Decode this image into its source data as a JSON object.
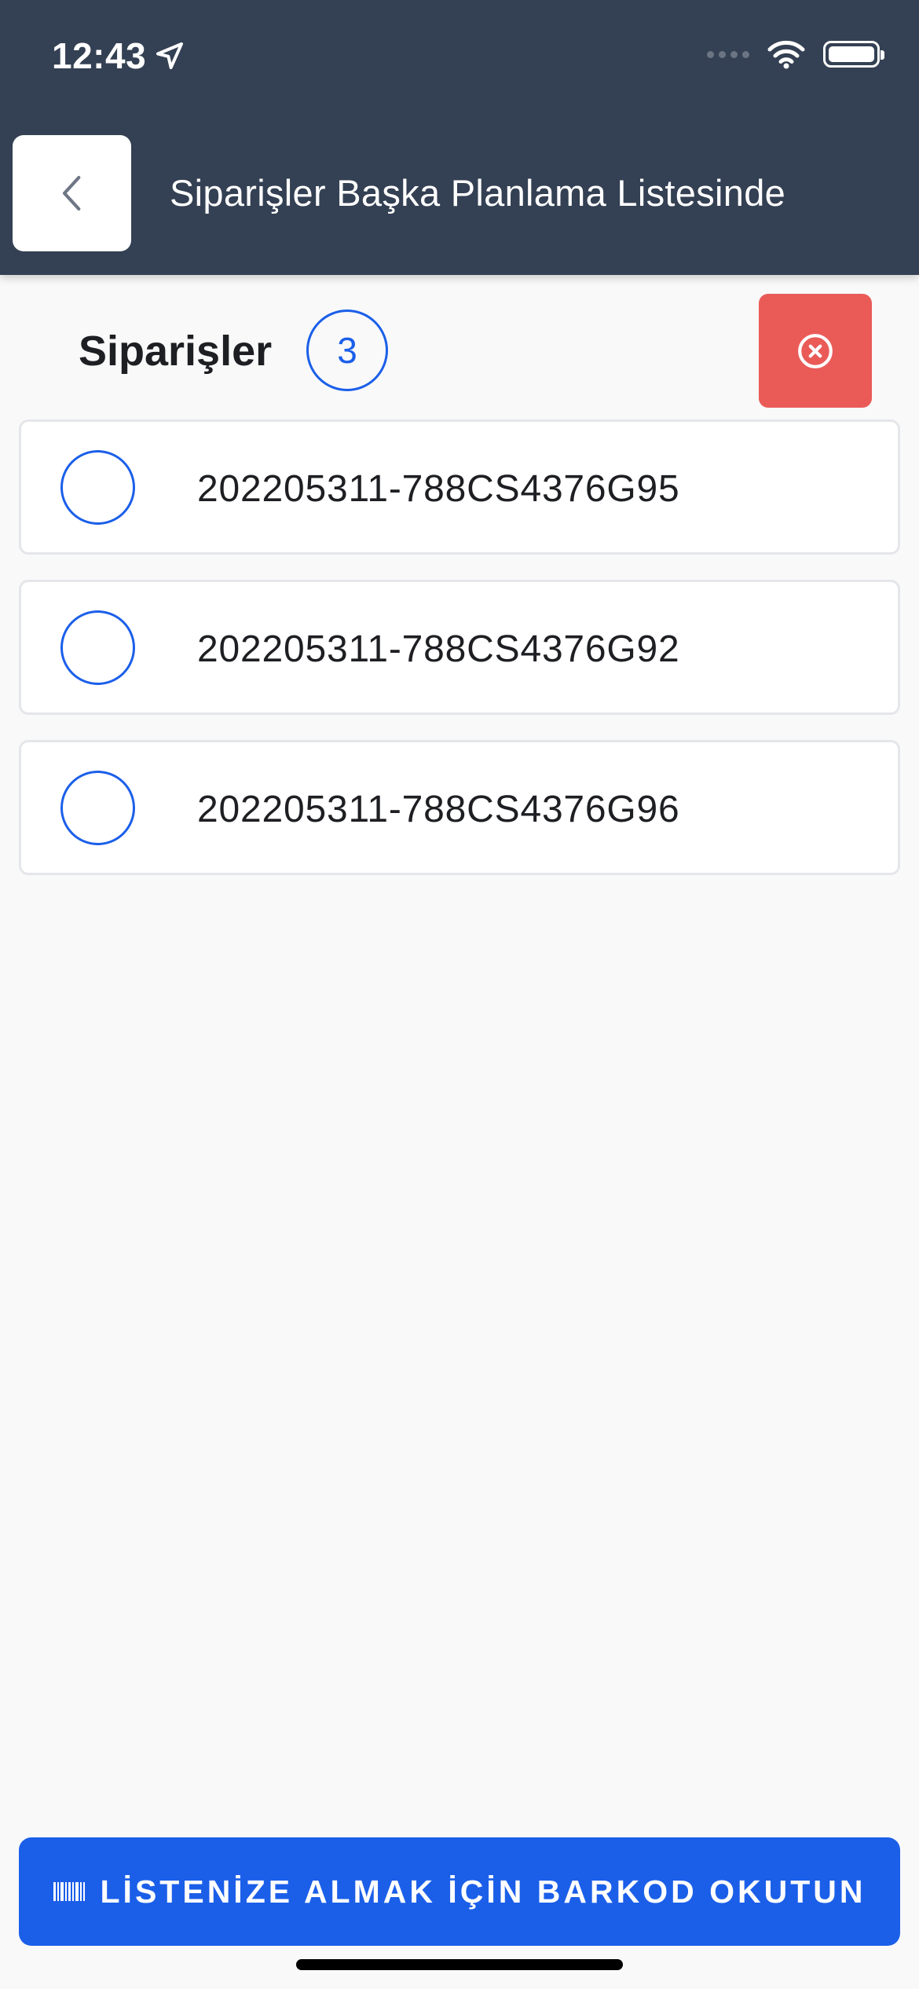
{
  "status_bar": {
    "time": "12:43",
    "location_icon": "location-arrow-icon",
    "icons": [
      "signal-icon",
      "wifi-icon",
      "battery-icon"
    ]
  },
  "header": {
    "title": "Siparişler Başka Planlama Listesinde",
    "back_icon": "chevron-left-icon",
    "background": "#344053"
  },
  "orders": {
    "label": "Siparişler",
    "count": "3",
    "clear_icon": "close-circle-icon",
    "items": [
      {
        "code": "202205311-788CS4376G95",
        "selected": false
      },
      {
        "code": "202205311-788CS4376G92",
        "selected": false
      },
      {
        "code": "202205311-788CS4376G96",
        "selected": false
      }
    ]
  },
  "scan_button": {
    "label": "LİSTENİZE ALMAK İÇİN BARKOD OKUTUN",
    "icon": "barcode-icon"
  },
  "colors": {
    "accent": "#1b5fe9",
    "danger": "#ea5b58",
    "header": "#344053"
  }
}
